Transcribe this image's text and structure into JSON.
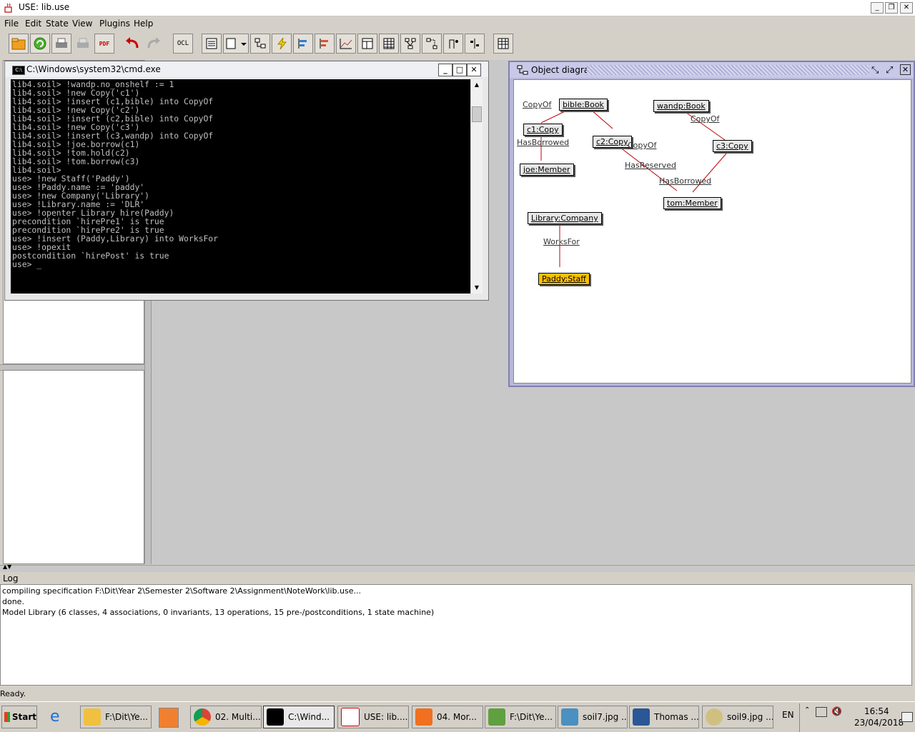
{
  "window": {
    "title": "USE: lib.use"
  },
  "menu": [
    "File",
    "Edit",
    "State",
    "View",
    "Plugins",
    "Help"
  ],
  "toolbar": {
    "ocl_label": "OCL",
    "pdf_label": "PDF"
  },
  "cmd": {
    "title": "C:\\Windows\\system32\\cmd.exe",
    "lines": [
      "lib4.soil> !wandp.no_onshelf := 1",
      "lib4.soil> !new Copy('c1')",
      "lib4.soil> !insert (c1,bible) into CopyOf",
      "lib4.soil> !new Copy('c2')",
      "lib4.soil> !insert (c2,bible) into CopyOf",
      "lib4.soil> !new Copy('c3')",
      "lib4.soil> !insert (c3,wandp) into CopyOf",
      "lib4.soil> !joe.borrow(c1)",
      "lib4.soil> !tom.hold(c2)",
      "lib4.soil> !tom.borrow(c3)",
      "lib4.soil>",
      "use> !new Staff('Paddy')",
      "use> !Paddy.name := 'paddy'",
      "use> !new Company('Library')",
      "use> !Library.name := 'DLR'",
      "use> !openter Library hire(Paddy)",
      "precondition `hirePre1' is true",
      "precondition `hirePre2' is true",
      "use> !insert (Paddy,Library) into WorksFor",
      "use> !opexit",
      "postcondition `hirePost' is true",
      "use> _"
    ]
  },
  "diagram": {
    "title": "Object diagram",
    "objects": {
      "bible": "bible:Book",
      "wandp": "wandp:Book",
      "c1": "c1:Copy",
      "c2": "c2:Copy",
      "c3": "c3:Copy",
      "joe": "joe:Member",
      "tom": "tom:Member",
      "library": "Library:Company",
      "paddy": "Paddy:Staff"
    },
    "labels": {
      "copyof1": "CopyOf",
      "copyof2": "CopyOf",
      "copyof3": "CopyOf",
      "hasborrowed1": "HasBorrowed",
      "hasborrowed2": "HasBorrowed",
      "hasreserved": "HasReserved",
      "worksfor": "WorksFor"
    },
    "link_color": "#c00000",
    "staff_color": "#ffc000"
  },
  "log": {
    "label": "Log",
    "lines": [
      "compiling specification F:\\Dit\\Year 2\\Semester 2\\Software 2\\Assignment\\NoteWork\\lib.use...",
      "done.",
      "Model Library (6 classes, 4 associations, 0 invariants, 13 operations, 15 pre-/postconditions, 1 state machine)"
    ]
  },
  "status": "Ready.",
  "taskbar": {
    "start": "Start",
    "tasks": [
      {
        "label": "F:\\Dit\\Ye...",
        "icon": "folder-icon"
      },
      {
        "label": "02. Multi...",
        "icon": "chrome-icon"
      },
      {
        "label": "C:\\Wind...",
        "icon": "cmd-icon"
      },
      {
        "label": "USE: lib....",
        "icon": "java-icon"
      },
      {
        "label": "04. Mor...",
        "icon": "pdf-icon"
      },
      {
        "label": "F:\\Dit\\Ye...",
        "icon": "editor-icon"
      },
      {
        "label": "soil7.jpg ...",
        "icon": "image-icon"
      },
      {
        "label": "Thomas ...",
        "icon": "word-icon"
      },
      {
        "label": "soil9.jpg ...",
        "icon": "paint-icon"
      }
    ],
    "lang": "EN",
    "time": "16:54",
    "date": "23/04/2018"
  }
}
